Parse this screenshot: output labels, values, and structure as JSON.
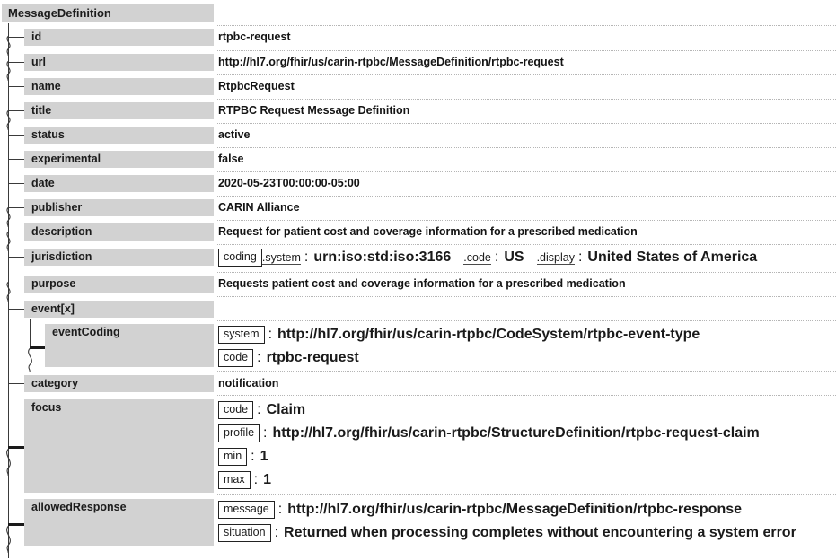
{
  "diagram": {
    "kind": "fhir-logical-structure-tree",
    "root_label": "MessageDefinition",
    "colors": {
      "label_chip_bg": "#d2d2d2",
      "tree_line": "#3a3a3a",
      "separator": "#b5b5b5",
      "text": "#1a1a1a",
      "box_border": "#222222",
      "page_bg": "#ffffff"
    }
  },
  "rows": [
    {
      "label": "id",
      "value": "rtpbc-request"
    },
    {
      "label": "url",
      "value": "http://hl7.org/fhir/us/carin-rtpbc/MessageDefinition/rtpbc-request"
    },
    {
      "label": "name",
      "value": "RtpbcRequest"
    },
    {
      "label": "title",
      "value": "RTPBC Request Message Definition"
    },
    {
      "label": "status",
      "value": "active"
    },
    {
      "label": "experimental",
      "value": "false"
    },
    {
      "label": "date",
      "value": "2020-05-23T00:00:00-05:00"
    },
    {
      "label": "publisher",
      "value": "CARIN Alliance"
    },
    {
      "label": "description",
      "value": "Request for patient cost and coverage information for a prescribed medication"
    },
    {
      "label": "jurisdiction",
      "value": ""
    },
    {
      "label": "purpose",
      "value": "Requests patient cost and coverage information for a prescribed medication"
    },
    {
      "label": "event[x]",
      "value": ""
    },
    {
      "label": "eventCoding",
      "value": ""
    },
    {
      "label": "category",
      "value": "notification"
    },
    {
      "label": "focus",
      "value": ""
    },
    {
      "label": "allowedResponse",
      "value": ""
    }
  ],
  "jurisdiction": {
    "type_box": "coding",
    "pairs": [
      {
        "key": ".system",
        "sep": ":",
        "value": "urn:iso:std:iso:3166"
      },
      {
        "key": ".code",
        "sep": ":",
        "value": "US"
      },
      {
        "key": ".display",
        "sep": ":",
        "value": "United States of America"
      }
    ]
  },
  "eventCoding": {
    "label": "eventCoding",
    "pairs": [
      {
        "key": "system",
        "sep": ":",
        "value": "http://hl7.org/fhir/us/carin-rtpbc/CodeSystem/rtpbc-event-type"
      },
      {
        "key": "code",
        "sep": ":",
        "value": "rtpbc-request"
      }
    ]
  },
  "focus": {
    "label": "focus",
    "pairs": [
      {
        "key": "code",
        "sep": ":",
        "value": "Claim"
      },
      {
        "key": "profile",
        "sep": ":",
        "value": "http://hl7.org/fhir/us/carin-rtpbc/StructureDefinition/rtpbc-request-claim"
      },
      {
        "key": "min",
        "sep": ":",
        "value": "1"
      },
      {
        "key": "max",
        "sep": ":",
        "value": "1"
      }
    ]
  },
  "allowedResponse": {
    "label": "allowedResponse",
    "pairs": [
      {
        "key": "message",
        "sep": ":",
        "value": "http://hl7.org/fhir/us/carin-rtpbc/MessageDefinition/rtpbc-response"
      },
      {
        "key": "situation",
        "sep": ":",
        "value": "Returned when processing completes without encountering a system error"
      }
    ]
  }
}
